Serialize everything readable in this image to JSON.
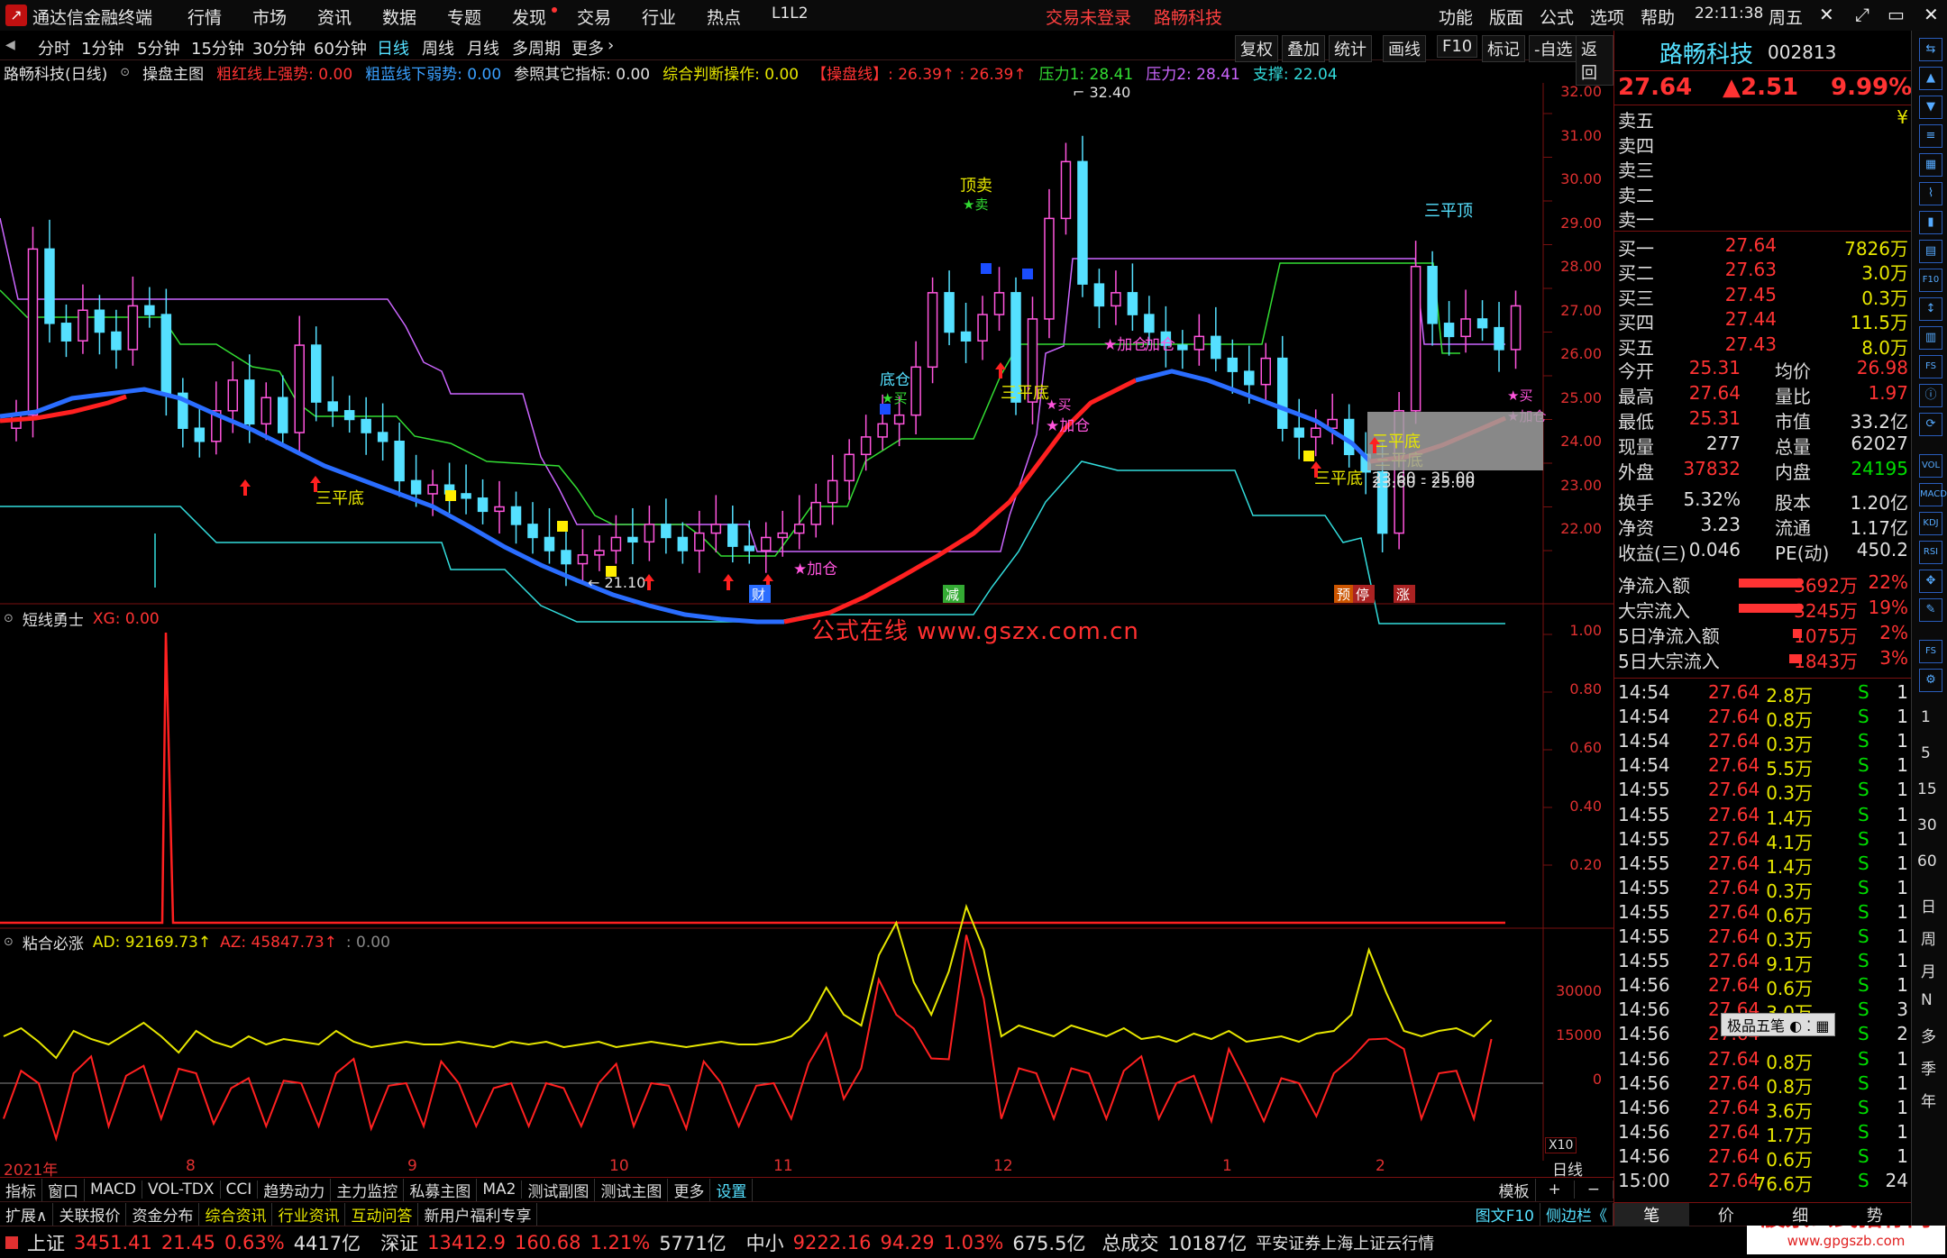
{
  "titlebar": {
    "app_title": "通达信金融终端",
    "menus": [
      "行情",
      "市场",
      "资讯",
      "数据",
      "专题",
      "发现",
      "交易",
      "行业",
      "热点",
      "L1L2"
    ],
    "login_status": "交易未登录",
    "stock_name": "路畅科技",
    "right_menus": [
      "功能",
      "版面",
      "公式",
      "选项",
      "帮助"
    ],
    "time": "22:11:38",
    "weekday": "周五",
    "window_controls": [
      "✕",
      "⤢",
      "▭",
      "—",
      "✕"
    ]
  },
  "period_tabs": [
    "分时",
    "1分钟",
    "5分钟",
    "15分钟",
    "30分钟",
    "60分钟",
    "日线",
    "周线",
    "月线",
    "多周期",
    "更多"
  ],
  "active_period": "日线",
  "tool_buttons": [
    "复权",
    "叠加",
    "统计",
    "画线",
    "F10",
    "标记",
    "-自选",
    "返回"
  ],
  "main_legend": {
    "title": "路畅科技(日线)",
    "formula": "操盘主图",
    "items": [
      {
        "text": "粗红线上强势: 0.00",
        "color": "#ff3333"
      },
      {
        "text": "粗蓝线下弱势: 0.00",
        "color": "#3aa0ff"
      },
      {
        "text": "参照其它指标: 0.00",
        "color": "#e0e0e0"
      },
      {
        "text": "综合判断操作: 0.00",
        "color": "#e6e600"
      },
      {
        "text": "【操盘线】: 26.39↑ : 26.39↑",
        "color": "#ff3333"
      },
      {
        "text": "压力1: 28.41",
        "color": "#33dd33"
      },
      {
        "text": "压力2: 28.41",
        "color": "#cc66ff"
      },
      {
        "text": "支撑: 22.04",
        "color": "#33dddd"
      }
    ]
  },
  "main_axis": [
    "32.00",
    "31.00",
    "30.00",
    "29.00",
    "28.00",
    "27.00",
    "26.00",
    "25.00",
    "24.00",
    "23.00",
    "22.00"
  ],
  "annotations": {
    "high": "32.40",
    "low": "21.10",
    "labels": [
      "三平底",
      "顶卖",
      "★卖",
      "底仓",
      "★买",
      "三平底",
      "★买",
      "★加仓",
      "★加仓",
      "加仓",
      "三平顶",
      "★买",
      "★加仓",
      "三平底",
      "三平底",
      "23.60 - 25.00",
      "★加仓"
    ],
    "badges": [
      "财",
      "减",
      "预",
      "停",
      "涨"
    ]
  },
  "panel2": {
    "title": "短线勇士",
    "value": "XG: 0.00",
    "axis": [
      "1.00",
      "0.80",
      "0.60",
      "0.40",
      "0.20"
    ],
    "watermark": "公式在线  www.gszx.com.cn"
  },
  "panel3": {
    "title": "粘合必涨",
    "ad": "AD: 92169.73↑",
    "az": "AZ: 45847.73↑",
    "extra": ": 0.00",
    "axis": [
      "30000",
      "15000",
      "0"
    ],
    "scale": "X10"
  },
  "time_axis": {
    "year": "2021年",
    "months": [
      "8",
      "9",
      "10",
      "11",
      "12",
      "1",
      "2"
    ],
    "period": "日线"
  },
  "bottom_tabs": [
    "指标",
    "窗口",
    "MACD",
    "VOL-TDX",
    "CCI",
    "趋势动力",
    "主力监控",
    "私募主图",
    "MA2",
    "测试副图",
    "测试主图",
    "更多",
    "设置"
  ],
  "bottom_tabs_right": [
    "模板",
    "+",
    "−"
  ],
  "bottom_tabs2": [
    "扩展∧",
    "关联报价",
    "资金分布",
    "综合资讯",
    "行业资讯",
    "互动问答",
    "新用户福利专享"
  ],
  "bottom_right2": [
    "图文F10",
    "侧边栏《"
  ],
  "status": {
    "sh": {
      "name": "上证",
      "price": "3451.41",
      "chg": "21.45",
      "pct": "0.63%",
      "amt": "4417亿"
    },
    "sz": {
      "name": "深证",
      "price": "13412.9",
      "chg": "160.68",
      "pct": "1.21%",
      "amt": "5771亿"
    },
    "zx": {
      "name": "中小",
      "price": "9222.16",
      "chg": "94.29",
      "pct": "1.03%",
      "amt": "675.5亿"
    },
    "total_label": "总成交",
    "total": "10187亿",
    "source": "平安证券上海上证云行情",
    "brand": "股票公式指标网",
    "brand_url": "www.gpgszb.com"
  },
  "quote": {
    "name": "路畅科技",
    "code": "002813",
    "price": "27.64",
    "change": "▲2.51",
    "pct": "9.99%",
    "sell": [
      {
        "label": "卖五",
        "price": "",
        "vol": "¥"
      },
      {
        "label": "卖四",
        "price": "",
        "vol": ""
      },
      {
        "label": "卖三",
        "price": "",
        "vol": ""
      },
      {
        "label": "卖二",
        "price": "",
        "vol": ""
      },
      {
        "label": "卖一",
        "price": "",
        "vol": ""
      }
    ],
    "buy": [
      {
        "label": "买一",
        "price": "27.64",
        "vol": "7826万"
      },
      {
        "label": "买二",
        "price": "27.63",
        "vol": "3.0万"
      },
      {
        "label": "买三",
        "price": "27.45",
        "vol": "0.3万"
      },
      {
        "label": "买四",
        "price": "27.44",
        "vol": "11.5万"
      },
      {
        "label": "买五",
        "price": "27.43",
        "vol": "8.0万"
      }
    ],
    "stats": [
      {
        "l1": "今开",
        "v1": "25.31",
        "c1": "cr",
        "l2": "均价",
        "v2": "26.98",
        "c2": "cr"
      },
      {
        "l1": "最高",
        "v1": "27.64",
        "c1": "cr",
        "l2": "量比",
        "v2": "1.97",
        "c2": "cr"
      },
      {
        "l1": "最低",
        "v1": "25.31",
        "c1": "cr",
        "l2": "市值",
        "v2": "33.2亿",
        "c2": "cw"
      },
      {
        "l1": "现量",
        "v1": "277",
        "c1": "cw",
        "l2": "总量",
        "v2": "62027",
        "c2": "cw"
      },
      {
        "l1": "外盘",
        "v1": "37832",
        "c1": "cr",
        "l2": "内盘",
        "v2": "24195",
        "c2": "cg"
      },
      {
        "l1": "换手",
        "v1": "5.32%",
        "c1": "cw",
        "l2": "股本",
        "v2": "1.20亿",
        "c2": "cw"
      },
      {
        "l1": "净资",
        "v1": "3.23",
        "c1": "cw",
        "l2": "流通",
        "v2": "1.17亿",
        "c2": "cw"
      },
      {
        "l1": "收益(三)",
        "v1": "0.046",
        "c1": "cw",
        "l2": "PE(动)",
        "v2": "450.2",
        "c2": "cw"
      }
    ],
    "flows": [
      {
        "label": "净流入额",
        "val": "3692万",
        "pct": "22%"
      },
      {
        "label": "大宗流入",
        "val": "3245万",
        "pct": "19%"
      },
      {
        "label": "5日净流入额",
        "val": "1075万",
        "pct": "2%"
      },
      {
        "label": "5日大宗流入",
        "val": "1843万",
        "pct": "3%"
      }
    ],
    "ticks": [
      [
        "14:54",
        "27.64",
        "2.8万",
        "S",
        "1"
      ],
      [
        "14:54",
        "27.64",
        "0.8万",
        "S",
        "1"
      ],
      [
        "14:54",
        "27.64",
        "0.3万",
        "S",
        "1"
      ],
      [
        "14:54",
        "27.64",
        "5.5万",
        "S",
        "1"
      ],
      [
        "14:55",
        "27.64",
        "0.3万",
        "S",
        "1"
      ],
      [
        "14:55",
        "27.64",
        "1.4万",
        "S",
        "1"
      ],
      [
        "14:55",
        "27.64",
        "4.1万",
        "S",
        "1"
      ],
      [
        "14:55",
        "27.64",
        "1.4万",
        "S",
        "1"
      ],
      [
        "14:55",
        "27.64",
        "0.3万",
        "S",
        "1"
      ],
      [
        "14:55",
        "27.64",
        "0.6万",
        "S",
        "1"
      ],
      [
        "14:55",
        "27.64",
        "0.3万",
        "S",
        "1"
      ],
      [
        "14:55",
        "27.64",
        "9.1万",
        "S",
        "1"
      ],
      [
        "14:56",
        "27.64",
        "0.6万",
        "S",
        "1"
      ],
      [
        "14:56",
        "27.64",
        "3.0万",
        "S",
        "3"
      ],
      [
        "14:56",
        "27.64",
        "",
        "S",
        "2"
      ],
      [
        "14:56",
        "27.64",
        "0.8万",
        "S",
        "1"
      ],
      [
        "14:56",
        "27.64",
        "0.8万",
        "S",
        "1"
      ],
      [
        "14:56",
        "27.64",
        "3.6万",
        "S",
        "1"
      ],
      [
        "14:56",
        "27.64",
        "1.7万",
        "S",
        "1"
      ],
      [
        "14:56",
        "27.64",
        "0.6万",
        "S",
        "1"
      ],
      [
        "15:00",
        "27.64",
        "76.6万",
        "S",
        "24"
      ]
    ],
    "popup": "极品五笔",
    "tabs": [
      "笔",
      "价",
      "细",
      "势"
    ]
  },
  "toolstrip": [
    "日",
    "周",
    "月",
    "N",
    "多",
    "季",
    "年"
  ],
  "toolstrip_nums": [
    "1",
    "5",
    "15",
    "30",
    "60"
  ]
}
